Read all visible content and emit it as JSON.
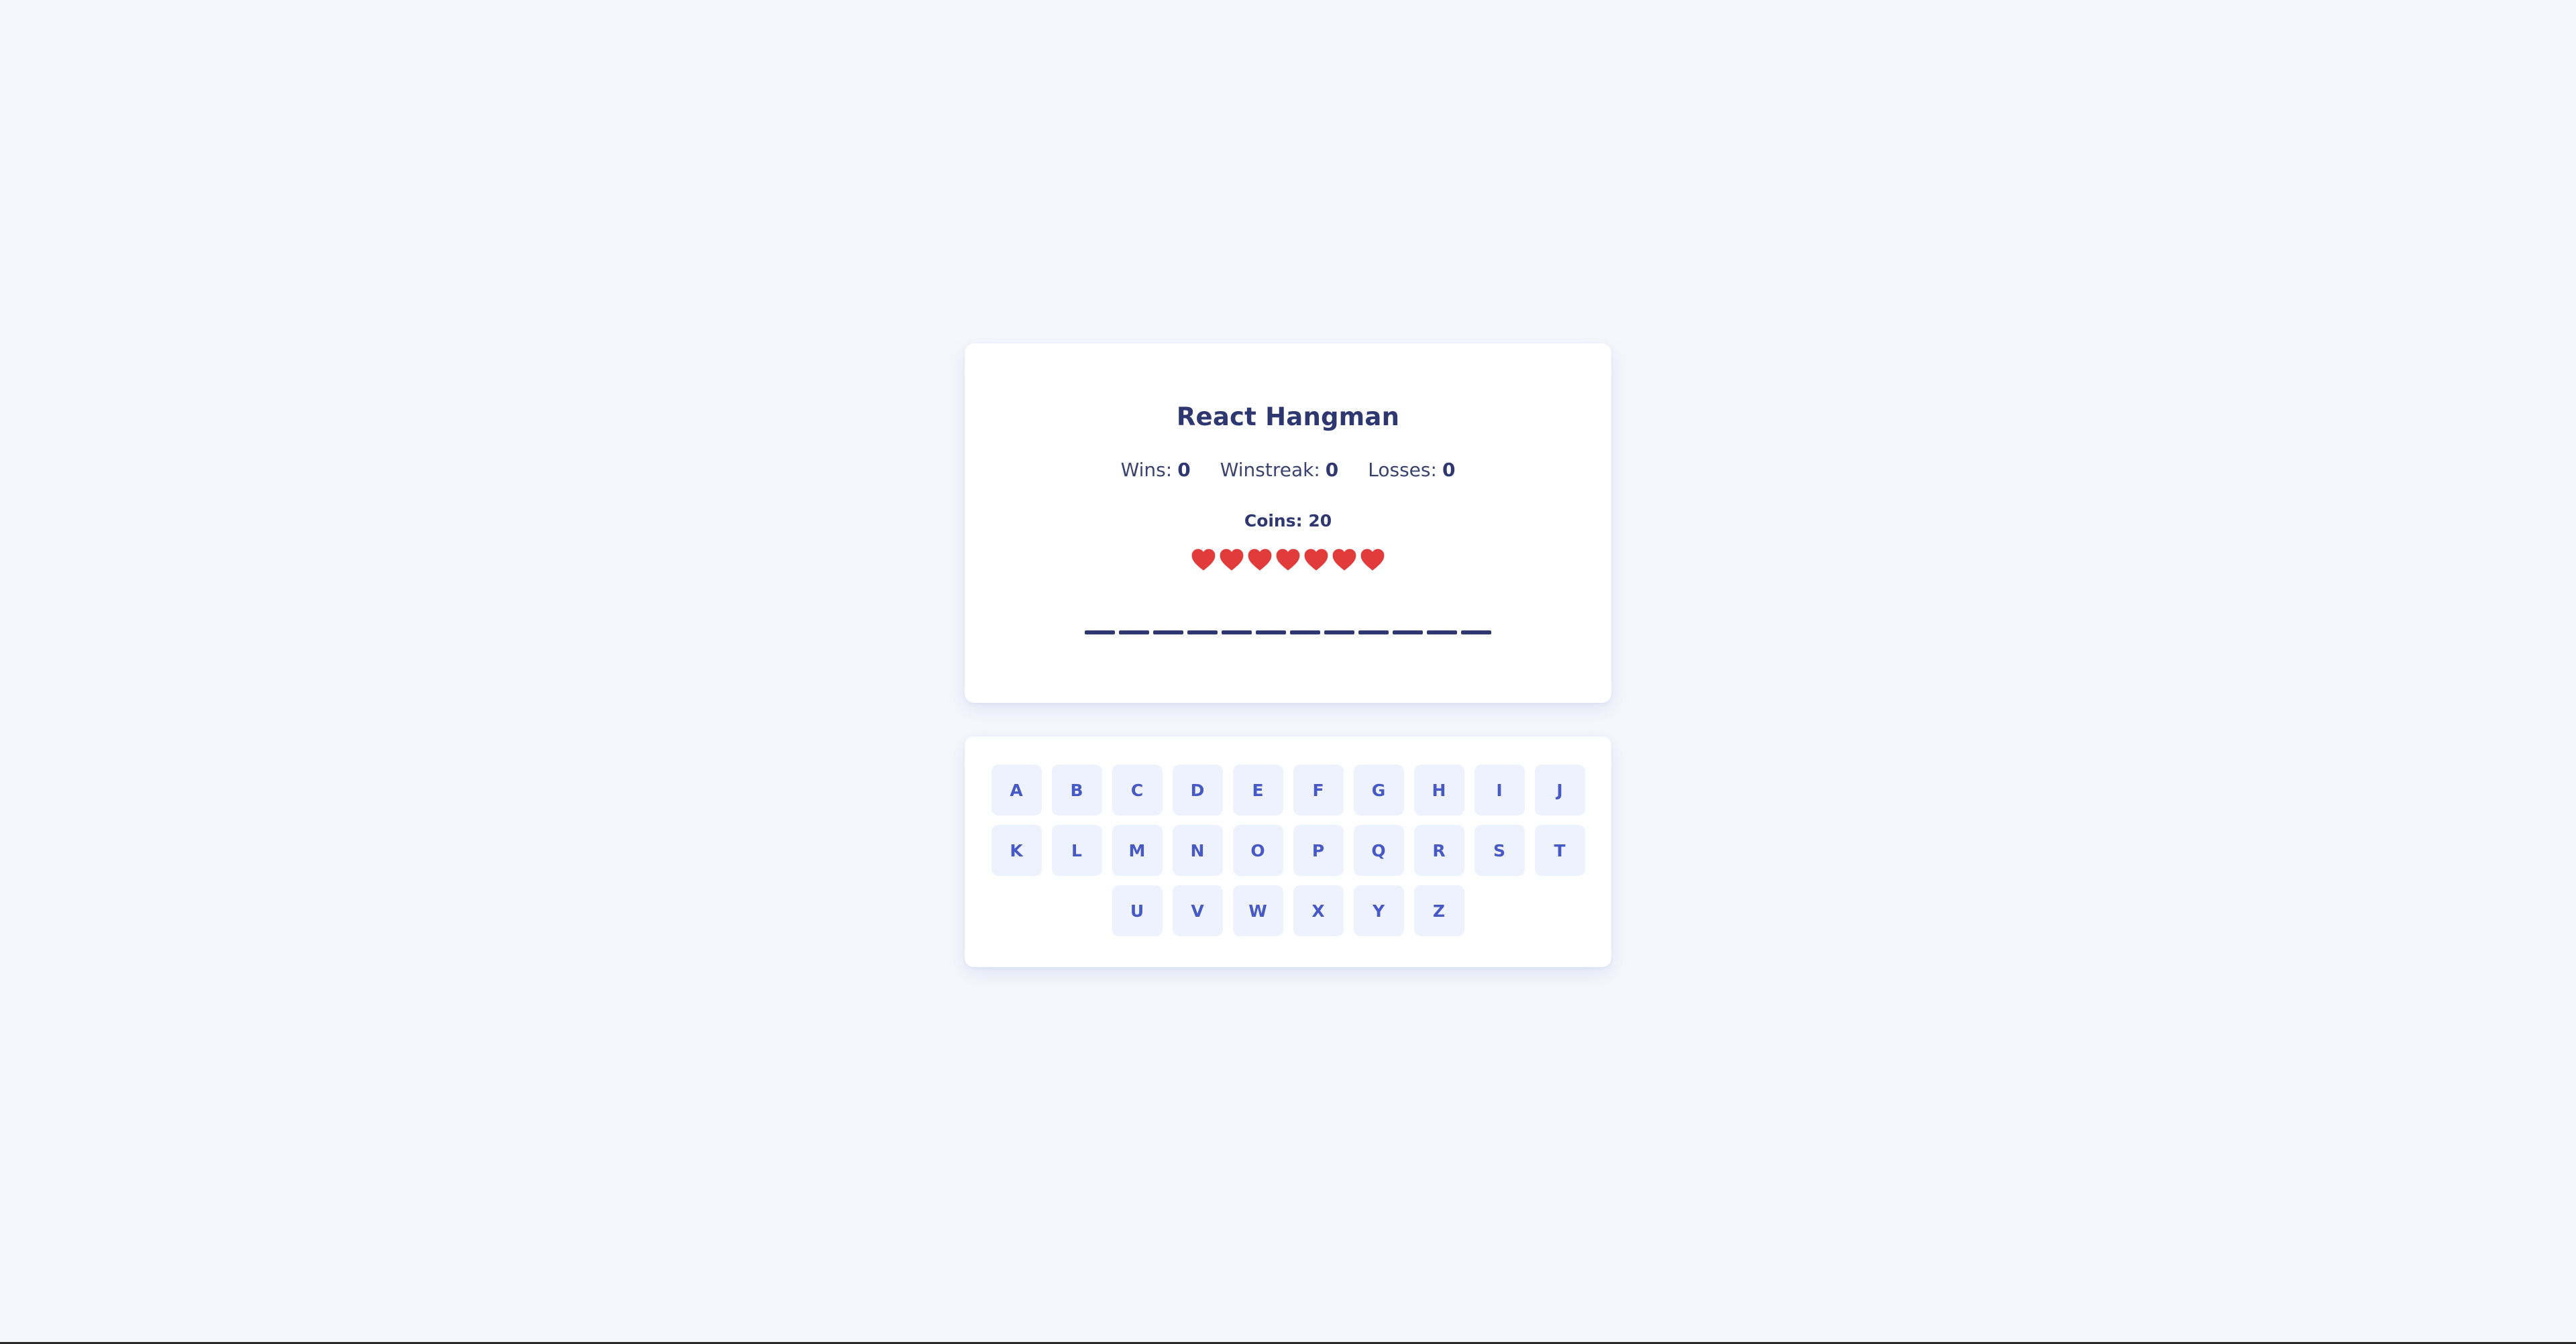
{
  "game": {
    "title": "React Hangman",
    "stats": {
      "wins_label": "Wins:",
      "wins_value": "0",
      "winstreak_label": "Winstreak:",
      "winstreak_value": "0",
      "losses_label": "Losses:",
      "losses_value": "0"
    },
    "coins_label": "Coins:",
    "coins_value": "20",
    "lives": 7,
    "heart_color": "#e23b3b",
    "word_length": 12
  },
  "keyboard": {
    "rows": [
      [
        "A",
        "B",
        "C",
        "D",
        "E",
        "F",
        "G",
        "H",
        "I",
        "J"
      ],
      [
        "K",
        "L",
        "M",
        "N",
        "O",
        "P",
        "Q",
        "R",
        "S",
        "T"
      ],
      [
        "U",
        "V",
        "W",
        "X",
        "Y",
        "Z"
      ]
    ]
  }
}
